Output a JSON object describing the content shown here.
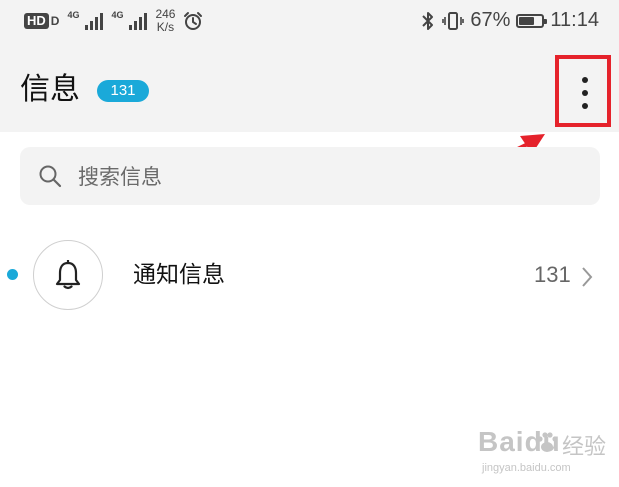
{
  "status_bar": {
    "hd_label": "HD",
    "hd_suffix": "D",
    "network_gen_1": "4G",
    "network_gen_2": "4G",
    "speed_value": "246",
    "speed_unit": "K/s",
    "battery_percent": "67%",
    "battery_level": 0.67,
    "time": "11:14",
    "icons": [
      "alarm-icon",
      "bluetooth-icon",
      "vibrate-icon",
      "battery-icon"
    ]
  },
  "header": {
    "title": "信息",
    "badge_count": "131",
    "menu_icon": "more-vertical-icon"
  },
  "search": {
    "placeholder": "搜索信息",
    "icon": "search-icon"
  },
  "conversations": [
    {
      "title": "通知信息",
      "count": "131",
      "unread": true,
      "icon": "bell-icon"
    }
  ],
  "watermark": {
    "brand": "Baidu",
    "cn": "经验",
    "url": "jingyan.baidu.com"
  },
  "colors": {
    "accent": "#1aa9d9",
    "highlight": "#e5222b",
    "header_bg": "#f3f3f3"
  }
}
